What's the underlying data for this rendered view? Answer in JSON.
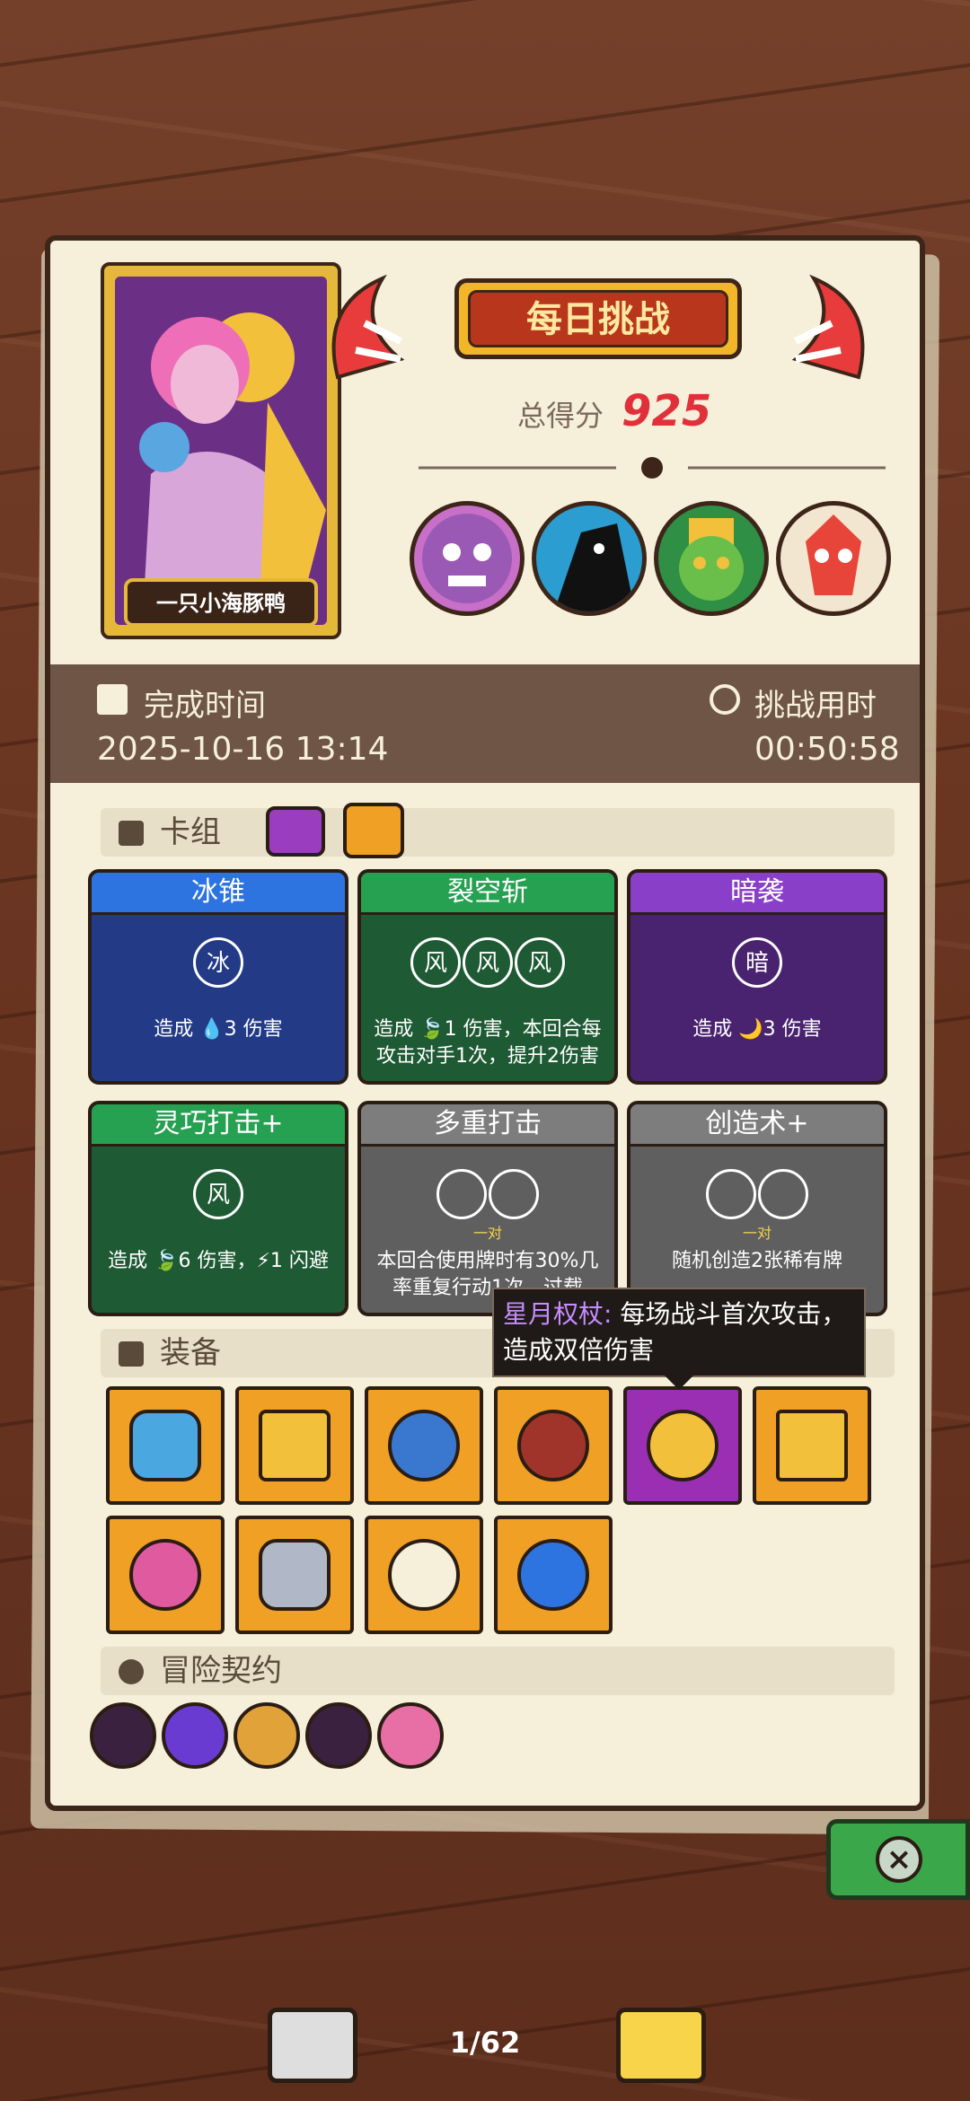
{
  "player": {
    "name": "一只小海豚鸭"
  },
  "title": "每日挑战",
  "score": {
    "label": "总得分",
    "value": "925"
  },
  "completion": {
    "label": "完成时间",
    "value": "2025-10-16 13:14"
  },
  "duration": {
    "label": "挑战用时",
    "value": "00:50:58"
  },
  "sections": {
    "deck": "卡组",
    "equipment": "装备",
    "contracts": "冒险契约"
  },
  "cards": [
    {
      "name": "冰锥",
      "glyphs": [
        "冰"
      ],
      "desc": "造成 💧3 伤害",
      "sub": "",
      "color": "blue"
    },
    {
      "name": "裂空斩",
      "glyphs": [
        "风",
        "风",
        "风"
      ],
      "desc": "造成 🍃1 伤害，本回合每攻击对手1次，提升2伤害",
      "sub": "",
      "color": "green"
    },
    {
      "name": "暗袭",
      "glyphs": [
        "暗"
      ],
      "desc": "造成 🌙3 伤害",
      "sub": "",
      "color": "purple"
    },
    {
      "name": "灵巧打击+",
      "glyphs": [
        "风"
      ],
      "desc": "造成 🍃6 伤害，⚡1 闪避",
      "sub": "",
      "color": "green"
    },
    {
      "name": "多重打击",
      "glyphs": [
        "",
        ""
      ],
      "desc": "本回合使用牌时有30%几率重复行动1次，过载",
      "sub": "一对",
      "color": "gray"
    },
    {
      "name": "创造术+",
      "glyphs": [
        "",
        ""
      ],
      "desc": "随机创造2张稀有牌",
      "sub": "一对",
      "color": "gray"
    }
  ],
  "tooltip": {
    "name": "星月权杖:",
    "text": "每场战斗首次攻击，造成双倍伤害"
  },
  "pager": "1/62",
  "colors": {
    "accent": "#e0303a",
    "panel": "#f6efd9",
    "equipment": "#f0a024",
    "selected": "#9a2fb3"
  }
}
